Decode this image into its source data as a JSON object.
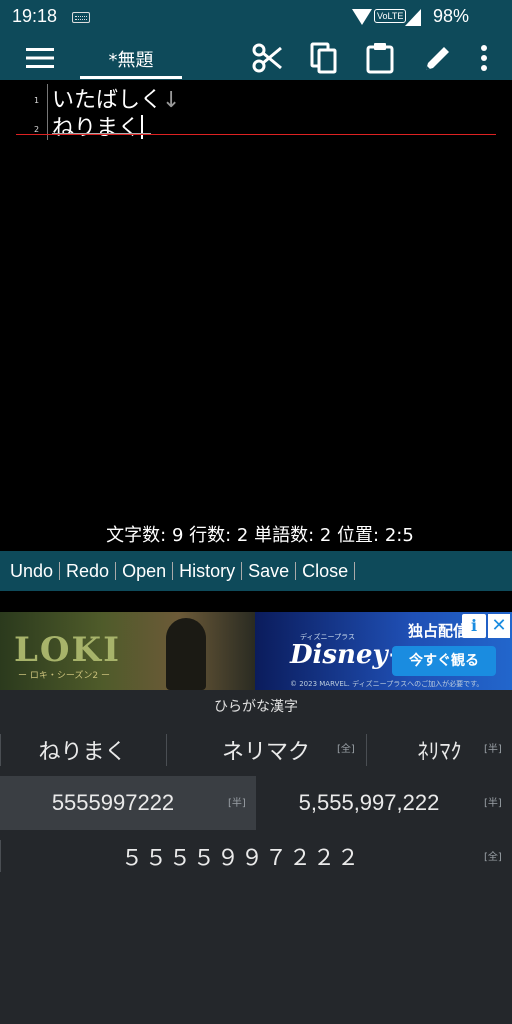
{
  "status_bar": {
    "time": "19:18",
    "volte_label": "VoLTE",
    "battery": "98%",
    "icons": [
      "keyboard-icon",
      "wifi-icon",
      "signal-icon"
    ]
  },
  "toolbar": {
    "title": "*無題",
    "icons": [
      "menu-icon",
      "cut-icon",
      "copy-icon",
      "paste-icon",
      "edit-icon",
      "more-icon"
    ]
  },
  "editor": {
    "lines": [
      {
        "number": "1",
        "text": "いたばしく",
        "mark": "↓"
      },
      {
        "number": "2",
        "text": "ねりまく",
        "mark": ""
      }
    ],
    "stats": "文字数: 9  行数: 2  単語数: 2  位置: 2:5"
  },
  "actions": [
    "Undo",
    "Redo",
    "Open",
    "History",
    "Save",
    "Close"
  ],
  "ad": {
    "loki_title": "LOKI",
    "loki_subtitle": "ー ロキ・シーズン2 ー",
    "disney_small": "ディズニープラス",
    "disney_logo": "Disney+",
    "headline": "独占配信",
    "cta": "今すぐ観る",
    "fine_print": "© 2023 MARVEL. ディズニープラスへのご加入が必要です。",
    "info": "i",
    "close": "✕"
  },
  "ime": {
    "mode": "ひらがな漢字",
    "row1": [
      {
        "text": "ねりまく",
        "tag": ""
      },
      {
        "text": "ネリマク",
        "tag": "[全]"
      },
      {
        "text": "ﾈﾘﾏｸ",
        "tag": "[半]"
      }
    ],
    "row2": [
      {
        "text": "5555997222",
        "tag": "[半]"
      },
      {
        "text": "5,555,997,222",
        "tag": "[半]"
      }
    ],
    "row3": [
      {
        "text": "５５５５９９７２２２",
        "tag": "[全]"
      }
    ]
  },
  "colors": {
    "app_bar": "#0e4a5a",
    "editor_bg": "#000000",
    "cursor_line": "#dd2222",
    "ime_bg": "#24272b",
    "ime_selected": "#3a3e43"
  }
}
